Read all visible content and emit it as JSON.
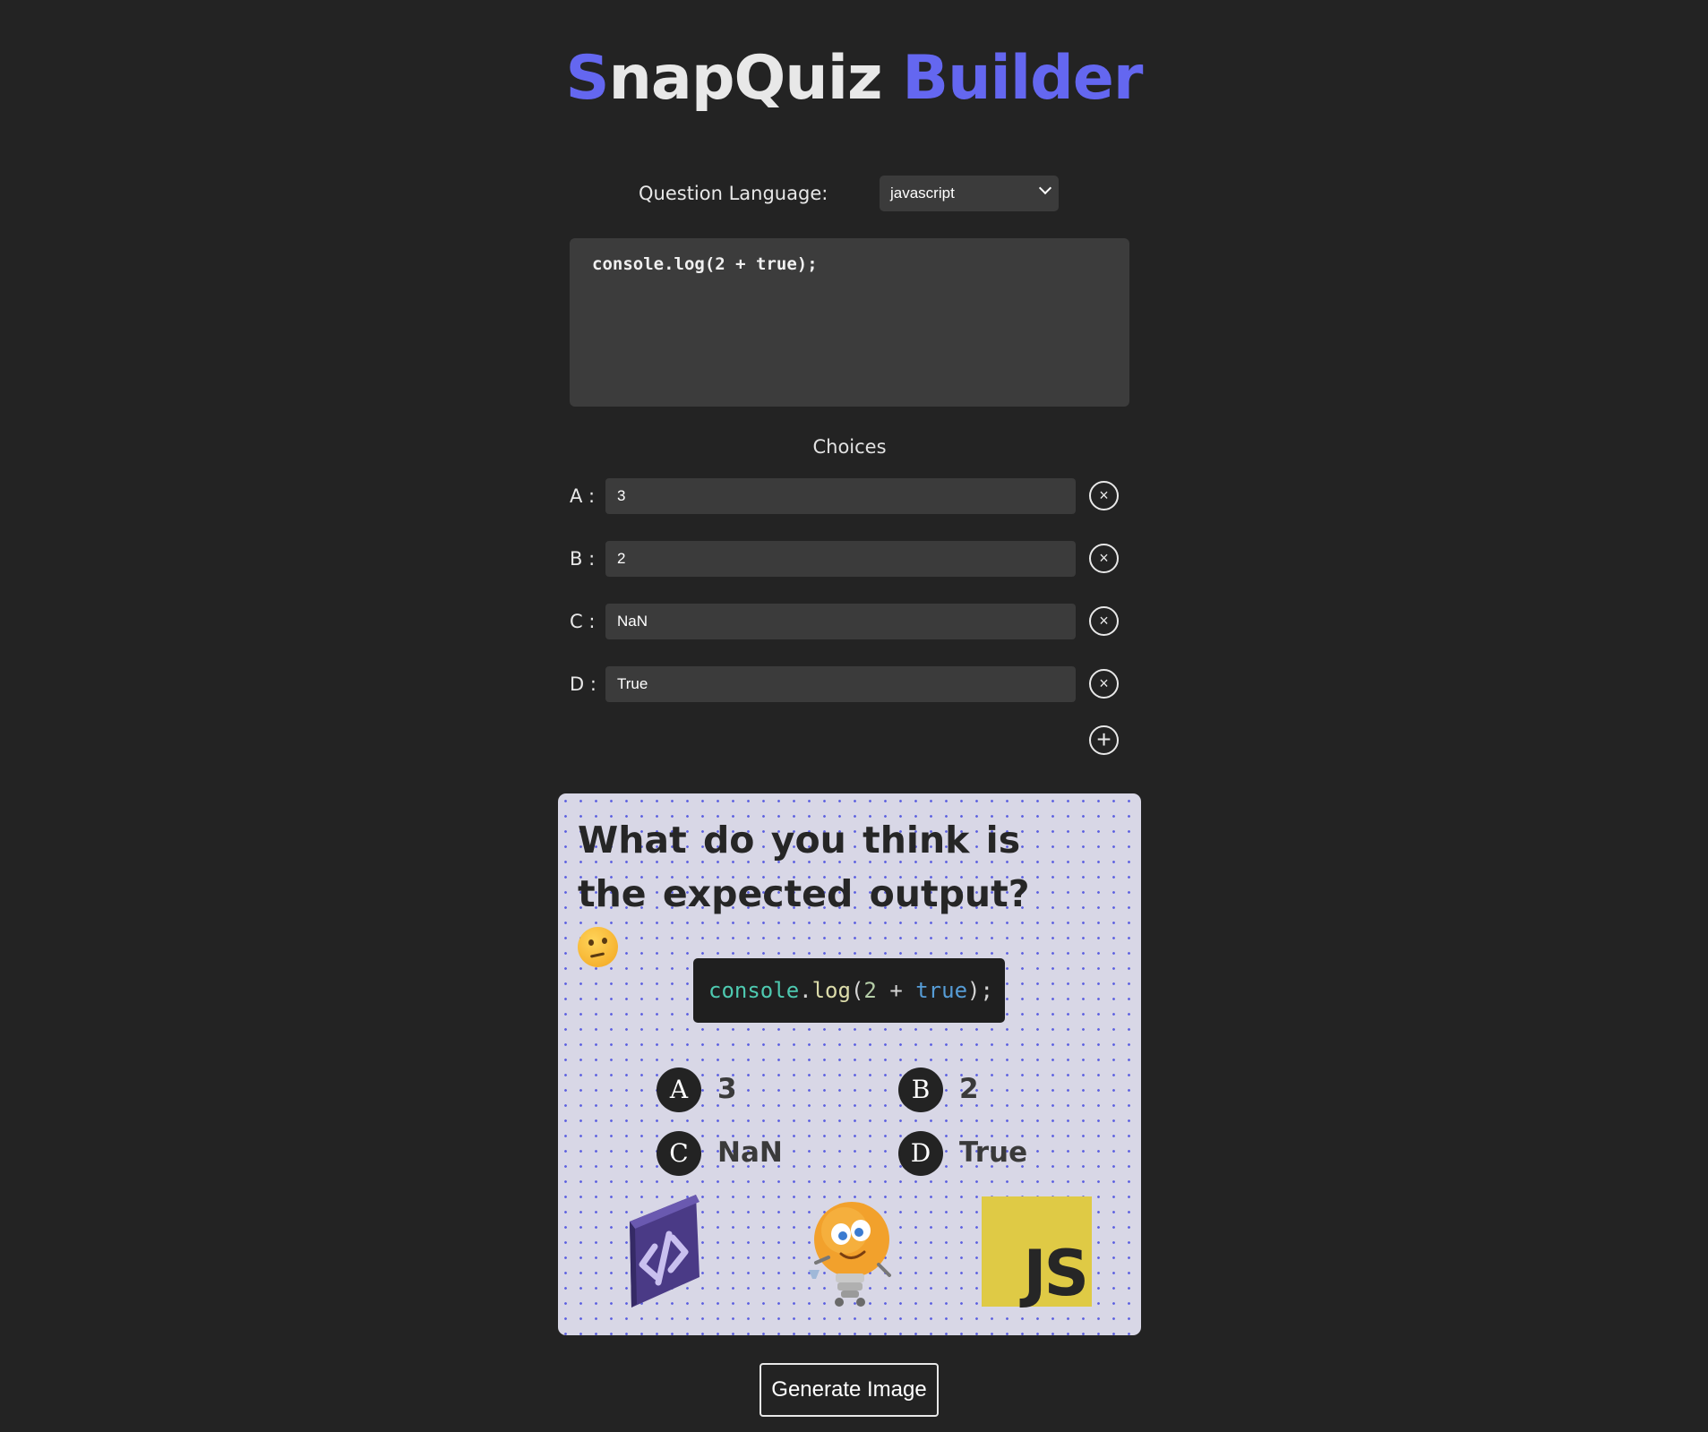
{
  "header": {
    "title_s": "S",
    "title_mid": "napQuiz ",
    "title_builder": "Builder"
  },
  "language": {
    "label": "Question Language:",
    "selected": "javascript"
  },
  "editor": {
    "code": "console.log(2 + true);"
  },
  "choices": {
    "heading": "Choices",
    "items": [
      {
        "letter": "A :",
        "value": "3"
      },
      {
        "letter": "B :",
        "value": "2"
      },
      {
        "letter": "C :",
        "value": "NaN"
      },
      {
        "letter": "D :",
        "value": "True"
      }
    ],
    "remove_icon": "×",
    "add_icon": "+"
  },
  "preview": {
    "question": "What do you think is the expected output?",
    "emoji": "thinking-face",
    "code_tokens": {
      "obj": "console",
      "dot": ".",
      "fn": "log",
      "open": "(",
      "num": "2",
      "op": " + ",
      "kw": "true",
      "close": ");"
    },
    "answers": [
      {
        "badge": "A",
        "text": "3"
      },
      {
        "badge": "B",
        "text": "2"
      },
      {
        "badge": "C",
        "text": "NaN"
      },
      {
        "badge": "D",
        "text": "True"
      }
    ],
    "logos": [
      "code-logo",
      "lightbulb-mascot",
      "javascript-logo"
    ],
    "js_logo_text": "JS"
  },
  "actions": {
    "generate_label": "Generate Image"
  },
  "colors": {
    "background": "#232323",
    "accent": "#6467f0",
    "card": "#d8d7e6",
    "js_yellow": "#dfca45"
  }
}
